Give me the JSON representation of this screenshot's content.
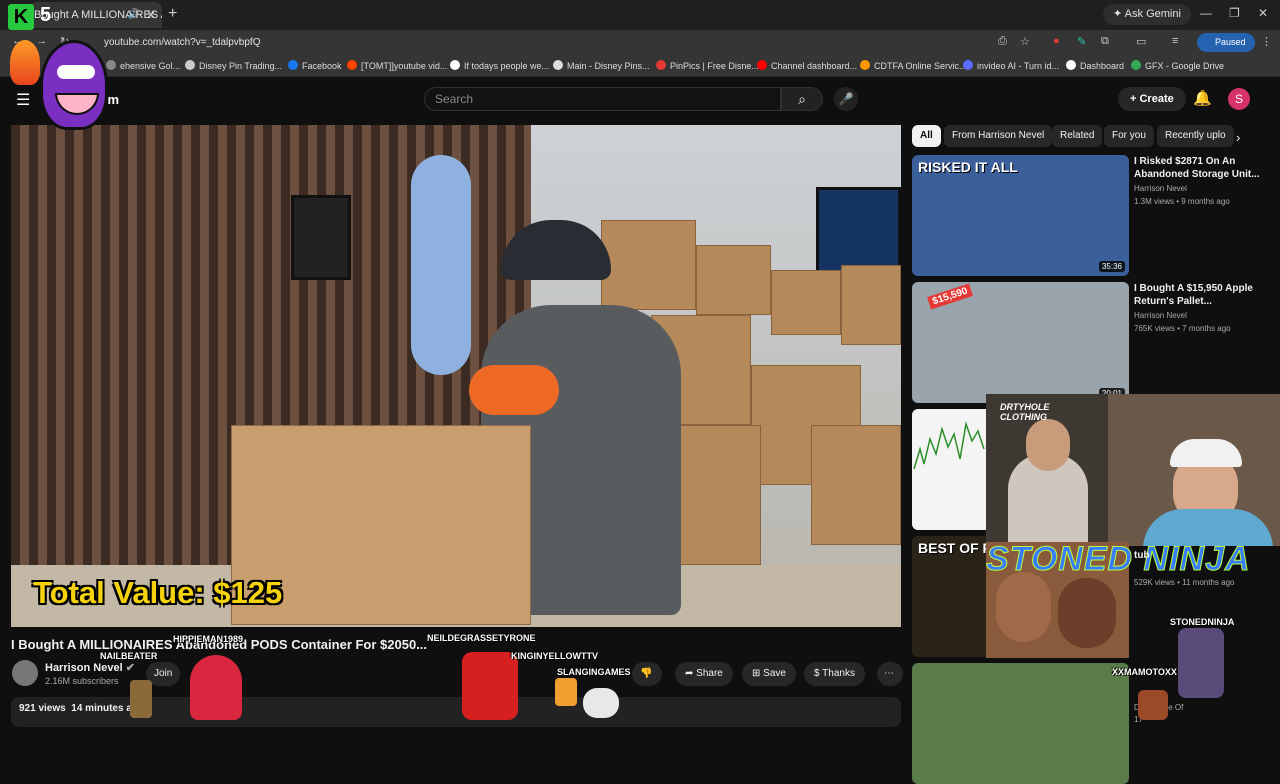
{
  "browser": {
    "tab_title": "Bought A MILLIONAIRES A",
    "tab_sound_icon": "speaker-icon",
    "address": "youtube.com/watch?v=_tdalpvbpfQ",
    "gemini_label": "Ask Gemini",
    "paused_label": "Paused",
    "bookmarks": [
      {
        "label": "ehensive Gol...",
        "color": "#888888"
      },
      {
        "label": "Disney Pin Trading...",
        "color": "#cccccc"
      },
      {
        "label": "Facebook",
        "color": "#1877f2"
      },
      {
        "label": "[TOMT]]youtube vid...",
        "color": "#ff4500"
      },
      {
        "label": "If todays people we...",
        "color": "#ffffff"
      },
      {
        "label": "Main - Disney Pins...",
        "color": "#dddddd"
      },
      {
        "label": "PinPics | Free Disne...",
        "color": "#e53935"
      },
      {
        "label": "Channel dashboard...",
        "color": "#ff0000"
      },
      {
        "label": "CDTFA Online Servic...",
        "color": "#ff9800"
      },
      {
        "label": "invideo AI - Turn id...",
        "color": "#5b6cff"
      },
      {
        "label": "Dashboard",
        "color": "#ffffff"
      },
      {
        "label": "GFX - Google Drive",
        "color": "#34a853"
      }
    ]
  },
  "header": {
    "logo_partial": "ium",
    "search_placeholder": "Search",
    "create_label": "Create",
    "avatar_letter": "S"
  },
  "video": {
    "overlay_text": "Total Value: $125",
    "title": "I Bought A MILLIONAIRES Abandoned PODS Container For $2050...",
    "channel": "Harrison Nevel",
    "subscribers": "2.16M subscribers",
    "join_label": "Join",
    "share_label": "Share",
    "save_label": "Save",
    "thanks_label": "Thanks",
    "views": "921 views",
    "time_ago": "14 minutes ago"
  },
  "chips": [
    {
      "label": "All",
      "selected": true
    },
    {
      "label": "From Harrison Nevel",
      "selected": false
    },
    {
      "label": "Related",
      "selected": false
    },
    {
      "label": "For you",
      "selected": false
    },
    {
      "label": "Recently uplo",
      "selected": false
    }
  ],
  "sidebar": [
    {
      "thumb_text": "RISKED IT ALL",
      "duration": "35:36",
      "title": "I Risked $2871 On An Abandoned Storage Unit...",
      "channel": "Harrison Nevel",
      "meta": "1.3M views • 9 months ago",
      "thumb_color": "#3b5f9a"
    },
    {
      "thumb_text": "$15,590",
      "duration": "20:01",
      "title": "I Bought A $15,950 Apple Return's Pallet...",
      "channel": "Harrison Nevel",
      "meta": "765K views • 7 months ago",
      "thumb_color": "#9aa4ad"
    },
    {
      "thumb_text": "",
      "duration": "",
      "title": "",
      "channel": "",
      "meta": "",
      "thumb_color": "#f4f4f4"
    },
    {
      "thumb_text": "BEST OF PART 8",
      "duration": "47:49",
      "title": "",
      "channel": "",
      "meta": "529K views • 11 months ago",
      "thumb_color": "#2a2418"
    },
    {
      "thumb_text": "",
      "duration": "",
      "title": "",
      "channel": "Daily Dose Of",
      "meta": "17",
      "thumb_color": "#5a7b4a"
    }
  ],
  "stream_overlay": {
    "k_logo": "K",
    "k_number": "5",
    "webcam_shirt_text": "DRTYHOLE CLOTHING",
    "banner_text": "STONED NINJA",
    "sidebar_partial_title": "tub",
    "chat_names": [
      "HIPPIEMAN1989",
      "NAILBEATER",
      "NEILDEGRASSETYRONE",
      "KINGINYELLOWTTV",
      "SLANGINGAMES",
      "STONEDNINJA",
      "XXMAMOTOXX"
    ]
  }
}
